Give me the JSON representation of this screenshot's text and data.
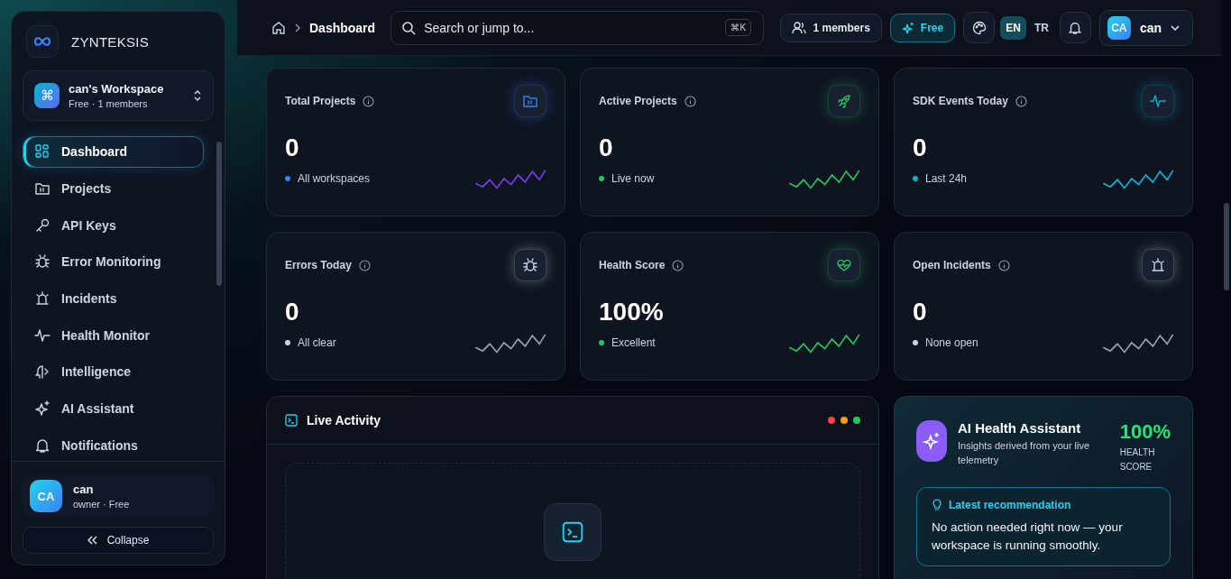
{
  "sidebar": {
    "brand": "ZYNTEKSIS",
    "workspace": {
      "icon_text": "⌘",
      "name": "can's Workspace",
      "meta": "Free · 1 members"
    },
    "items": [
      {
        "label": "Dashboard",
        "selected": true
      },
      {
        "label": "Projects",
        "selected": false
      },
      {
        "label": "API Keys",
        "selected": false
      },
      {
        "label": "Error Monitoring",
        "selected": false
      },
      {
        "label": "Incidents",
        "selected": false
      },
      {
        "label": "Health Monitor",
        "selected": false
      },
      {
        "label": "Intelligence",
        "selected": false
      },
      {
        "label": "AI Assistant",
        "selected": false
      },
      {
        "label": "Notifications",
        "selected": false
      }
    ],
    "user": {
      "initials": "CA",
      "name": "can",
      "meta": "owner · Free"
    },
    "collapse": "Collapse"
  },
  "header": {
    "breadcrumb": "Dashboard",
    "search": {
      "placeholder": "Search or jump to...",
      "shortcut": "⌘K"
    },
    "members": "1 members",
    "plan": "Free",
    "languages": [
      {
        "label": "EN",
        "selected": true
      },
      {
        "label": "TR",
        "selected": false
      }
    ],
    "user": {
      "initials": "CA",
      "name": "can"
    }
  },
  "metrics": [
    {
      "title": "Total Projects",
      "value": "0",
      "note": "All workspaces",
      "color": "#3b82f6"
    },
    {
      "title": "Active Projects",
      "value": "0",
      "note": "Live now",
      "color": "#22c55e"
    },
    {
      "title": "SDK Events Today",
      "value": "0",
      "note": "Last 24h",
      "color": "#06b6d4"
    },
    {
      "title": "Errors Today",
      "value": "0",
      "note": "All clear",
      "color": "#cbd5e1"
    },
    {
      "title": "Health Score",
      "value": "100%",
      "note": "Excellent",
      "color": "#22c55e"
    },
    {
      "title": "Open Incidents",
      "value": "0",
      "note": "None open",
      "color": "#cbd5e1"
    }
  ],
  "live_activity": {
    "title": "Live Activity"
  },
  "ai_assistant": {
    "title": "AI Health Assistant",
    "subtitle": "Insights derived from your live telemetry",
    "score": "100%",
    "score_label": "HEALTH SCORE",
    "recommendation": {
      "title": "Latest recommendation",
      "text": "No action needed right now — your workspace is running smoothly."
    }
  }
}
